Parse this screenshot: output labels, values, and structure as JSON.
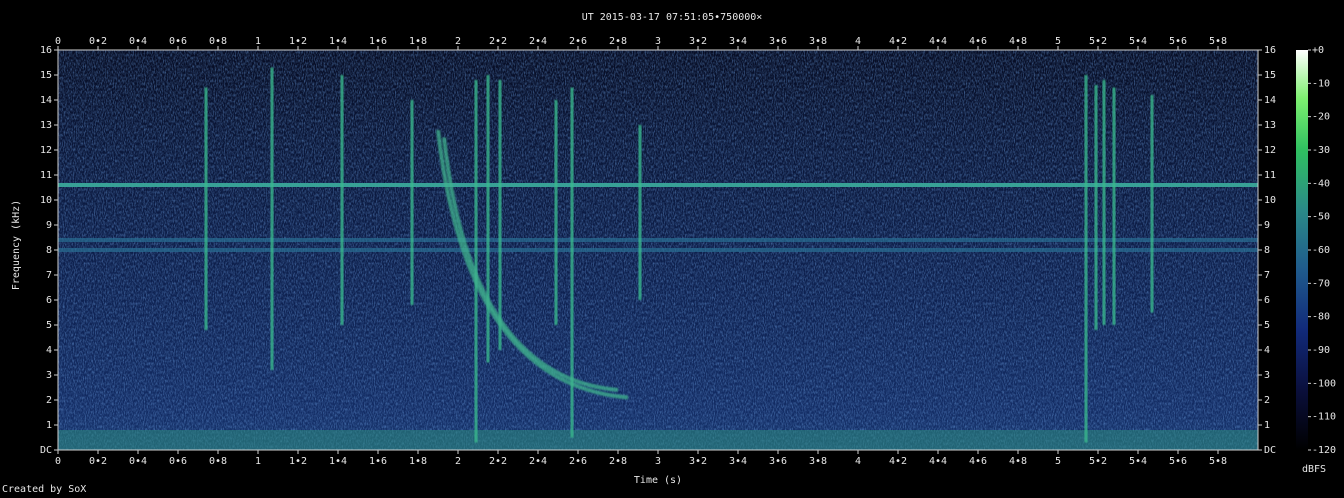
{
  "chart_data": {
    "type": "heatmap",
    "title": "UT 2015-03-17 07:51:05•750000×",
    "xlabel": "Time (s)",
    "ylabel": "Frequency (kHz)",
    "xlim": [
      0,
      6
    ],
    "ylim": [
      0,
      16
    ],
    "x_ticks": [
      "0",
      "0•2",
      "0•4",
      "0•6",
      "0•8",
      "1",
      "1•2",
      "1•4",
      "1•6",
      "1•8",
      "2",
      "2•2",
      "2•4",
      "2•6",
      "2•8",
      "3",
      "3•2",
      "3•4",
      "3•6",
      "3•8",
      "4",
      "4•2",
      "4•4",
      "4•6",
      "4•8",
      "5",
      "5•2",
      "5•4",
      "5•6",
      "5•8"
    ],
    "y_ticks": [
      "DC",
      "1",
      "2",
      "3",
      "4",
      "5",
      "6",
      "7",
      "8",
      "9",
      "10",
      "11",
      "12",
      "13",
      "14",
      "15",
      "16"
    ],
    "colorbar": {
      "label": "dBFS",
      "ticks": [
        "+0",
        "-10",
        "-20",
        "-30",
        "-40",
        "-50",
        "-60",
        "-70",
        "-80",
        "-90",
        "-100",
        "-110",
        "-120"
      ],
      "range": [
        -120,
        0
      ]
    },
    "features": {
      "horizontal_lines_khz": [
        10.6,
        8.4,
        8.0
      ],
      "vertical_impulses": [
        {
          "t": 0.74,
          "f_low": 4.8,
          "f_high": 14.5
        },
        {
          "t": 1.07,
          "f_low": 3.2,
          "f_high": 15.3
        },
        {
          "t": 1.42,
          "f_low": 5.0,
          "f_high": 15.0
        },
        {
          "t": 1.77,
          "f_low": 5.8,
          "f_high": 14.0
        },
        {
          "t": 2.09,
          "f_low": 0.3,
          "f_high": 14.8
        },
        {
          "t": 2.15,
          "f_low": 3.5,
          "f_high": 15.0
        },
        {
          "t": 2.21,
          "f_low": 4.0,
          "f_high": 14.8
        },
        {
          "t": 2.49,
          "f_low": 5.0,
          "f_high": 14.0
        },
        {
          "t": 2.57,
          "f_low": 0.5,
          "f_high": 14.5
        },
        {
          "t": 2.91,
          "f_low": 6.0,
          "f_high": 13.0
        },
        {
          "t": 5.14,
          "f_low": 0.3,
          "f_high": 15.0
        },
        {
          "t": 5.19,
          "f_low": 4.8,
          "f_high": 14.6
        },
        {
          "t": 5.23,
          "f_low": 5.0,
          "f_high": 14.8
        },
        {
          "t": 5.28,
          "f_low": 5.0,
          "f_high": 14.5
        },
        {
          "t": 5.47,
          "f_low": 5.5,
          "f_high": 14.2
        }
      ],
      "whistler_traces": [
        {
          "t_start": 1.9,
          "f_start": 12.8,
          "t_end": 2.85,
          "f_end": 2.1
        },
        {
          "t_start": 1.93,
          "f_start": 12.5,
          "t_end": 2.8,
          "f_end": 2.4
        }
      ]
    }
  },
  "footer": {
    "credit": "Created by SoX"
  }
}
